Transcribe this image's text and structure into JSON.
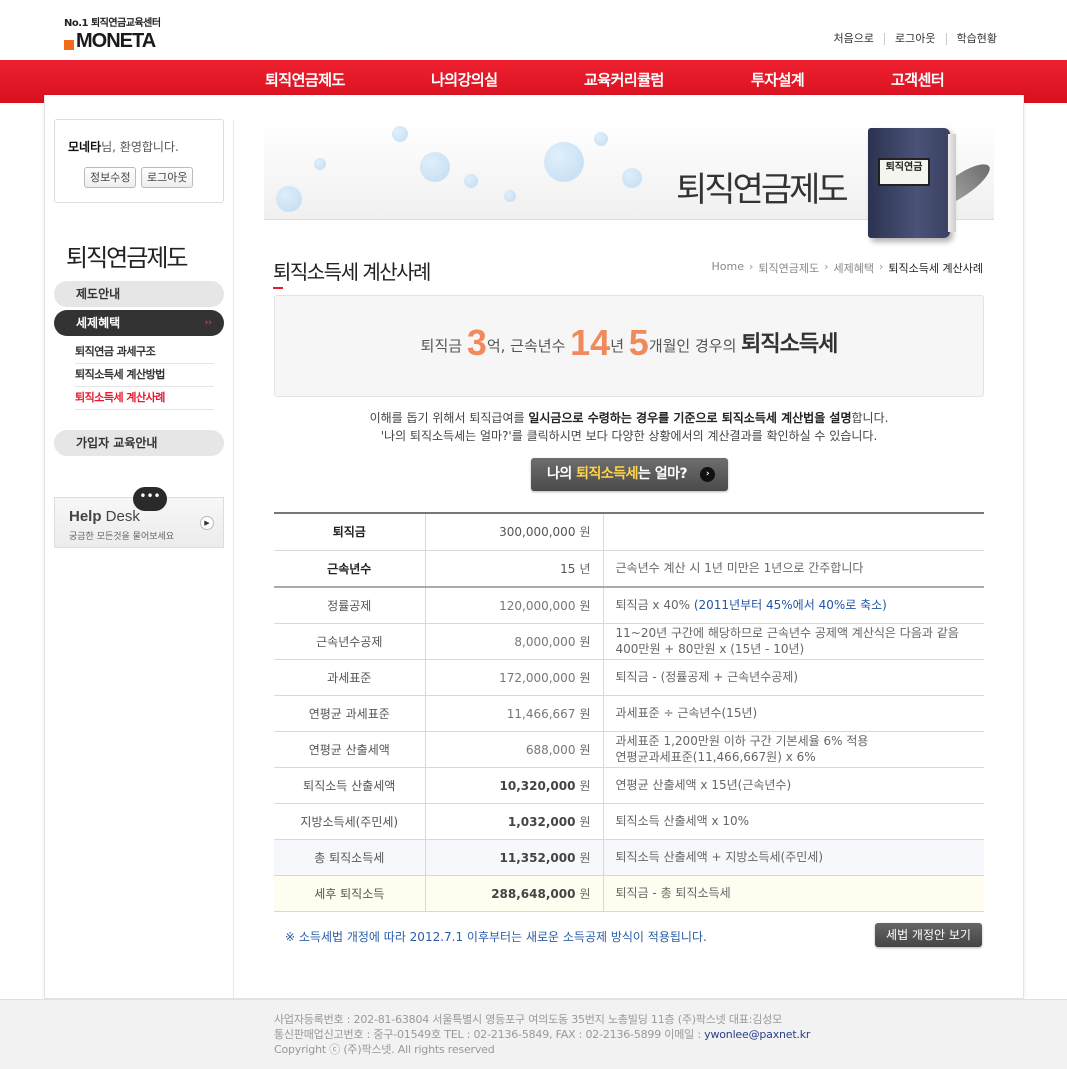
{
  "header": {
    "logo_tag": "No.1 퇴직연금교육센터",
    "logo_name": "MONETA",
    "util": [
      "처음으로",
      "로그아웃",
      "학습현황"
    ]
  },
  "gnb": [
    "퇴직연금제도",
    "나의강의실",
    "교육커리큘럼",
    "투자설계",
    "고객센터"
  ],
  "sidebar": {
    "welcome_name": "모네타",
    "welcome_suffix": "님, 환영합니다.",
    "edit_button": "정보수정",
    "logout_button": "로그아웃",
    "section_title": "퇴직연금제도",
    "menu": {
      "system": "제도안내",
      "tax": "세제혜택",
      "sub": [
        "퇴직연금 과세구조",
        "퇴직소득세 계산방법",
        "퇴직소득세 계산사례"
      ],
      "member": "가입자 교육안내",
      "arrow": "››"
    },
    "help": {
      "title_bold": "Help",
      "title_rest": " Desk",
      "subtitle": "궁금한 모든것을 물어보세요",
      "bubble": "•••",
      "go": "▶"
    }
  },
  "banner": {
    "title": "퇴직연금제도",
    "book_label": "퇴직연금"
  },
  "page": {
    "title": "퇴직소득세 계산사례",
    "breadcrumb": [
      "Home",
      "퇴직연금제도",
      "세제혜택",
      "퇴직소득세 계산사례"
    ]
  },
  "summary": {
    "p1": "퇴직금 ",
    "n1": "3",
    "p2": "억,  근속년수 ",
    "n2": "14",
    "p3": "년 ",
    "n3": "5",
    "p4": "개월인 경우의 ",
    "strong": "퇴직소득세"
  },
  "desc": {
    "l1_a": "이해를 돕기 위해서 퇴직급여를 ",
    "l1_b": "일시금으로 수령하는 경우를 기준으로 퇴직소득세 계산법을 설명",
    "l1_c": "합니다.",
    "l2": "'나의 퇴직소득세는 얼마?'를 클릭하시면 보다 다양한 상황에서의 계산결과를 확인하실 수 있습니다."
  },
  "cta": {
    "a": "나의 ",
    "hl": "퇴직소득세",
    "b": "는 얼마?",
    "icon": "›"
  },
  "table": {
    "rows": [
      {
        "label": "퇴직금",
        "value": "300,000,000",
        "unit": "원",
        "note": ""
      },
      {
        "label": "근속년수",
        "value": "15",
        "unit": "년",
        "note": "근속년수 계산 시 1년 미만은 1년으로 간주합니다"
      },
      {
        "label": "정률공제",
        "value": "120,000,000",
        "unit": "원",
        "note": "퇴직금 x 40% ",
        "note_blue": "(2011년부터 45%에서 40%로 축소)"
      },
      {
        "label": "근속년수공제",
        "value": "8,000,000",
        "unit": "원",
        "note": "11~20년 구간에 해당하므로 근속년수 공제액 계산식은 다음과 같음",
        "note2": "400만원 + 80만원 x (15년 - 10년)"
      },
      {
        "label": "과세표준",
        "value": "172,000,000",
        "unit": "원",
        "note": "퇴직금 - (정률공제 + 근속년수공제)"
      },
      {
        "label": "연평균 과세표준",
        "value": "11,466,667",
        "unit": "원",
        "note": "과세표준 ÷ 근속년수(15년)"
      },
      {
        "label": "연평균 산출세액",
        "value": "688,000",
        "unit": "원",
        "note": "과세표준 1,200만원 이하 구간 기본세율 6% 적용",
        "note2": "연평균과세표준(11,466,667원) x 6%"
      },
      {
        "label": "퇴직소득 산출세액",
        "value": "10,320,000",
        "unit": "원",
        "note": "연평균 산출세액 x 15년(근속년수)"
      },
      {
        "label": "지방소득세(주민세)",
        "value": "1,032,000",
        "unit": "원",
        "note": "퇴직소득 산출세액 x 10%"
      },
      {
        "label": "총 퇴직소득세",
        "value": "11,352,000",
        "unit": "원",
        "note": "퇴직소득 산출세액 + 지방소득세(주민세)"
      },
      {
        "label": "세후 퇴직소득",
        "value": "288,648,000",
        "unit": "원",
        "note": "퇴직금 - 총 퇴직소득세"
      }
    ]
  },
  "notice": {
    "text": "※ 소득세법 개정에 따라 2012.7.1 이후부터는 새로운 소득공제 방식이 적용됩니다.",
    "button": "세법 개정안 보기"
  },
  "footer": {
    "line1": "사업자등록번호 : 202-81-63804 서울특별시 영등포구 여의도동 35번지 노총빌딩 11층 (주)팍스넷 대표:김성모",
    "line2_a": "통신판매업신고번호 : 중구-01549호 TEL : 02-2136-5849, FAX : 02-2136-5899 이메일 : ",
    "line2_mail": "ywonlee@paxnet.kr",
    "line3": "Copyright ⓒ (주)팍스넷. All rights reserved"
  }
}
